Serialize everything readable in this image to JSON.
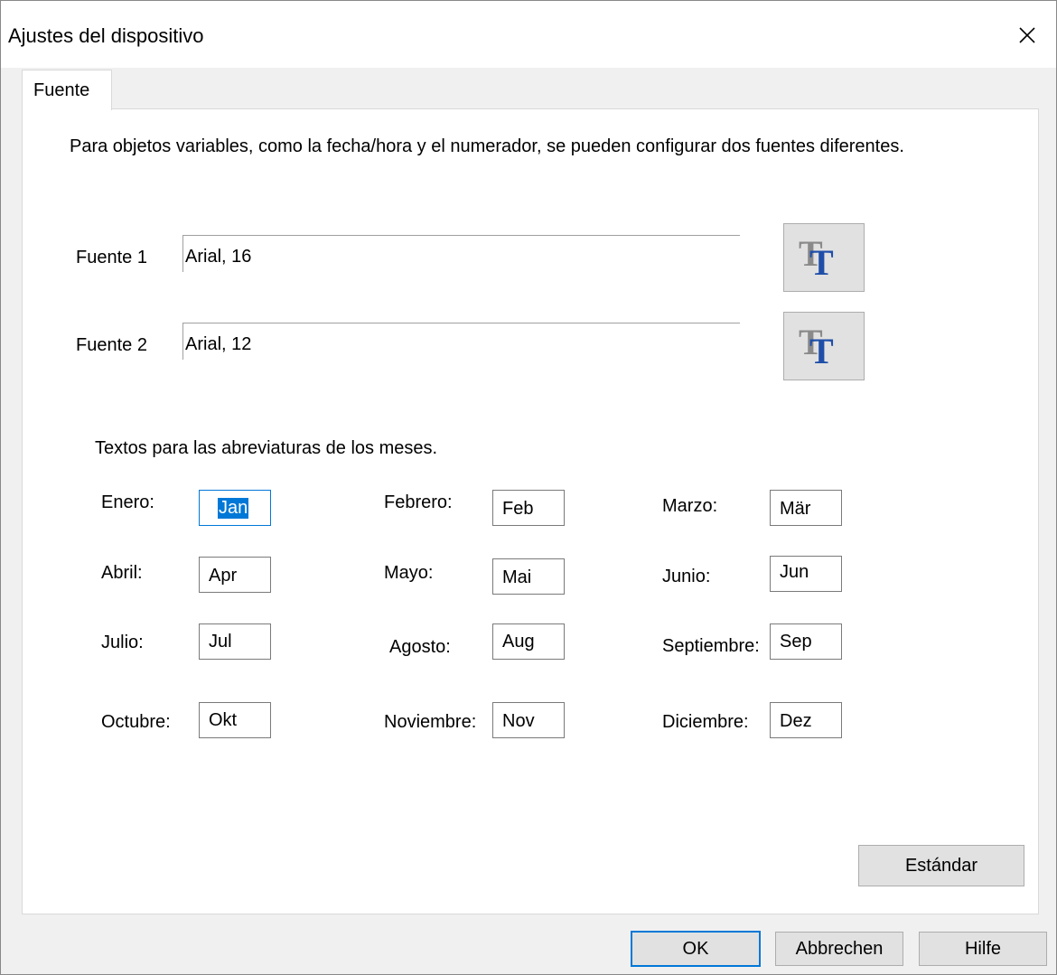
{
  "window": {
    "title": "Ajustes del dispositivo"
  },
  "tabs": [
    {
      "label": "Fuente",
      "selected": true
    }
  ],
  "description": "Para objetos variables, como la fecha/hora y el numerador, se pueden configurar dos fuentes diferentes.",
  "fonts": [
    {
      "label": "Fuente 1",
      "value": "Arial, 16"
    },
    {
      "label": "Fuente 2",
      "value": "Arial, 12"
    }
  ],
  "months_heading": "Textos para las abreviaturas de los meses.",
  "months": [
    {
      "label": "Enero:",
      "value": "Jan"
    },
    {
      "label": "Febrero:",
      "value": "Feb"
    },
    {
      "label": "Marzo:",
      "value": "Mär"
    },
    {
      "label": "Abril:",
      "value": "Apr"
    },
    {
      "label": "Mayo:",
      "value": "Mai"
    },
    {
      "label": "Junio:",
      "value": "Jun"
    },
    {
      "label": "Julio:",
      "value": "Jul"
    },
    {
      "label": "Agosto:",
      "value": "Aug"
    },
    {
      "label": "Septiembre:",
      "value": "Sep"
    },
    {
      "label": "Octubre:",
      "value": "Okt"
    },
    {
      "label": "Noviembre:",
      "value": "Nov"
    },
    {
      "label": "Diciembre:",
      "value": "Dez"
    }
  ],
  "buttons": {
    "standard": "Estándar",
    "ok": "OK",
    "cancel": "Abbrechen",
    "help": "Hilfe"
  },
  "colors": {
    "selection": "#0078d7",
    "icon_blue": "#1f4fa8",
    "icon_gray": "#8a8a8a"
  }
}
